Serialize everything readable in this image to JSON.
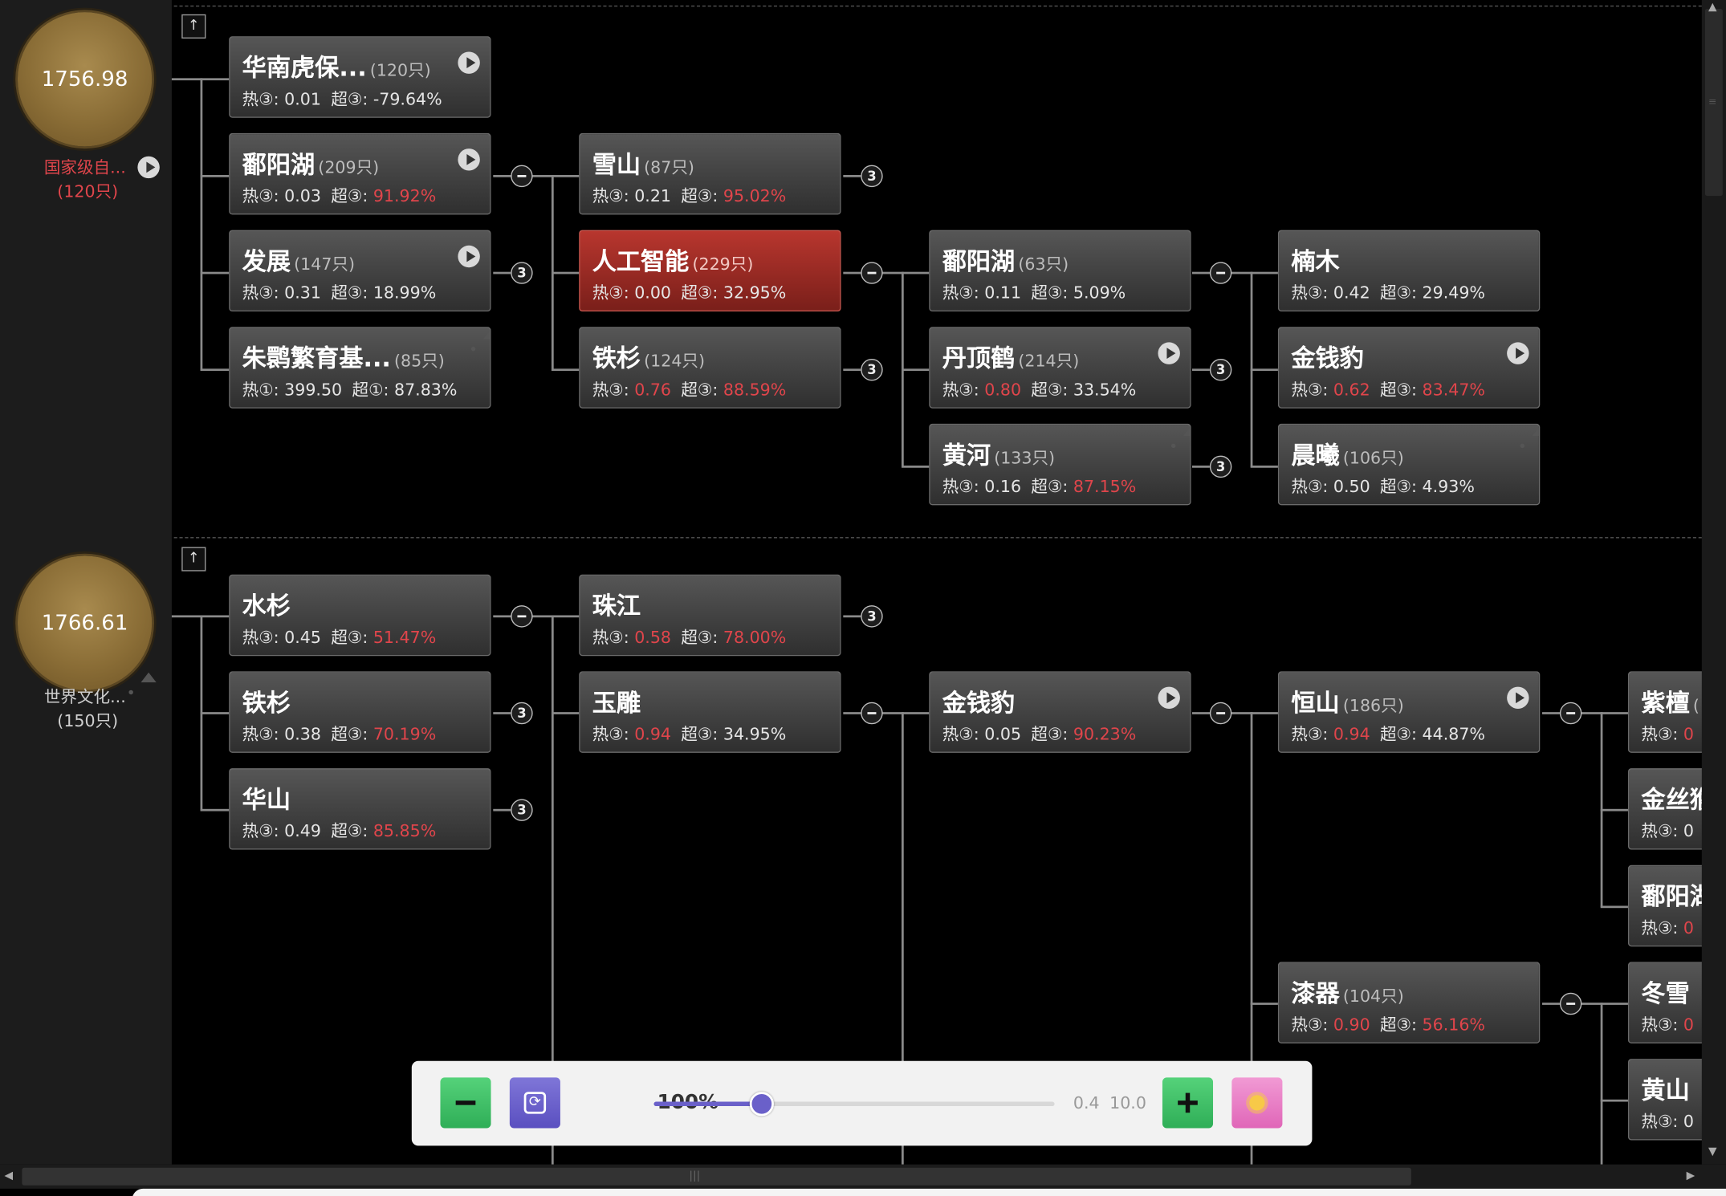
{
  "colors": {
    "accent_red": "#e0454b",
    "coin_gold": "#8a6d36",
    "selected_node": "#a82e27"
  },
  "groups": [
    {
      "value": "1756.98",
      "label": "国家级自...",
      "count": "(120只)",
      "icon": "play-icon",
      "label_color": "red"
    },
    {
      "value": "1766.61",
      "label": "世界文化...",
      "count": "(150只)",
      "icon": "image-icon",
      "label_color": "grey"
    }
  ],
  "nodes": [
    {
      "name": "华南虎保...",
      "count": "(120只)",
      "h_label": "热③:",
      "h_val": "0.01",
      "h_red": false,
      "c_label": "超③:",
      "c_val": "-79.64%",
      "c_red": false,
      "icon": "play-icon",
      "selected": false
    },
    {
      "name": "鄱阳湖",
      "count": "(209只)",
      "h_label": "热③:",
      "h_val": "0.03",
      "h_red": false,
      "c_label": "超③:",
      "c_val": "91.92%",
      "c_red": true,
      "icon": "play-icon",
      "selected": false
    },
    {
      "name": "发展",
      "count": "(147只)",
      "h_label": "热③:",
      "h_val": "0.31",
      "h_red": false,
      "c_label": "超③:",
      "c_val": "18.99%",
      "c_red": false,
      "icon": "play-icon",
      "selected": false
    },
    {
      "name": "朱鹮繁育基...",
      "count": "(85只)",
      "h_label": "热①:",
      "h_val": "399.50",
      "h_red": false,
      "c_label": "超①:",
      "c_val": "87.83%",
      "c_red": false,
      "icon": "image-icon",
      "selected": false
    },
    {
      "name": "雪山",
      "count": "(87只)",
      "h_label": "热③:",
      "h_val": "0.21",
      "h_red": false,
      "c_label": "超③:",
      "c_val": "95.02%",
      "c_red": true,
      "icon": "",
      "selected": false
    },
    {
      "name": "人工智能",
      "count": "(229只)",
      "h_label": "热③:",
      "h_val": "0.00",
      "h_red": false,
      "c_label": "超③:",
      "c_val": "32.95%",
      "c_red": false,
      "icon": "",
      "selected": true
    },
    {
      "name": "铁杉",
      "count": "(124只)",
      "h_label": "热③:",
      "h_val": "0.76",
      "h_red": true,
      "c_label": "超③:",
      "c_val": "88.59%",
      "c_red": true,
      "icon": "",
      "selected": false
    },
    {
      "name": "鄱阳湖",
      "count": "(63只)",
      "h_label": "热③:",
      "h_val": "0.11",
      "h_red": false,
      "c_label": "超③:",
      "c_val": "5.09%",
      "c_red": false,
      "icon": "",
      "selected": false
    },
    {
      "name": "丹顶鹤",
      "count": "(214只)",
      "h_label": "热③:",
      "h_val": "0.80",
      "h_red": true,
      "c_label": "超③:",
      "c_val": "33.54%",
      "c_red": false,
      "icon": "play-icon",
      "selected": false
    },
    {
      "name": "黄河",
      "count": "(133只)",
      "h_label": "热③:",
      "h_val": "0.16",
      "h_red": false,
      "c_label": "超③:",
      "c_val": "87.15%",
      "c_red": true,
      "icon": "image-icon",
      "selected": false
    },
    {
      "name": "楠木",
      "count": "",
      "h_label": "热③:",
      "h_val": "0.42",
      "h_red": false,
      "c_label": "超③:",
      "c_val": "29.49%",
      "c_red": false,
      "icon": "",
      "selected": false
    },
    {
      "name": "金钱豹",
      "count": "",
      "h_label": "热③:",
      "h_val": "0.62",
      "h_red": true,
      "c_label": "超③:",
      "c_val": "83.47%",
      "c_red": true,
      "icon": "play-icon",
      "selected": false
    },
    {
      "name": "晨曦",
      "count": "(106只)",
      "h_label": "热③:",
      "h_val": "0.50",
      "h_red": false,
      "c_label": "超③:",
      "c_val": "4.93%",
      "c_red": false,
      "icon": "image-icon",
      "selected": false
    },
    {
      "name": "水杉",
      "count": "",
      "h_label": "热③:",
      "h_val": "0.45",
      "h_red": false,
      "c_label": "超③:",
      "c_val": "51.47%",
      "c_red": true,
      "icon": "",
      "selected": false
    },
    {
      "name": "铁杉",
      "count": "",
      "h_label": "热③:",
      "h_val": "0.38",
      "h_red": false,
      "c_label": "超③:",
      "c_val": "70.19%",
      "c_red": true,
      "icon": "",
      "selected": false
    },
    {
      "name": "华山",
      "count": "",
      "h_label": "热③:",
      "h_val": "0.49",
      "h_red": false,
      "c_label": "超③:",
      "c_val": "85.85%",
      "c_red": true,
      "icon": "",
      "selected": false
    },
    {
      "name": "珠江",
      "count": "",
      "h_label": "热③:",
      "h_val": "0.58",
      "h_red": true,
      "c_label": "超③:",
      "c_val": "78.00%",
      "c_red": true,
      "icon": "",
      "selected": false
    },
    {
      "name": "玉雕",
      "count": "",
      "h_label": "热③:",
      "h_val": "0.94",
      "h_red": true,
      "c_label": "超③:",
      "c_val": "34.95%",
      "c_red": false,
      "icon": "",
      "selected": false
    },
    {
      "name": "金钱豹",
      "count": "",
      "h_label": "热③:",
      "h_val": "0.05",
      "h_red": false,
      "c_label": "超③:",
      "c_val": "90.23%",
      "c_red": true,
      "icon": "play-icon",
      "selected": false
    },
    {
      "name": "恒山",
      "count": "(186只)",
      "h_label": "热③:",
      "h_val": "0.94",
      "h_red": true,
      "c_label": "超③:",
      "c_val": "44.87%",
      "c_red": false,
      "icon": "play-icon",
      "selected": false
    },
    {
      "name": "漆器",
      "count": "(104只)",
      "h_label": "热③:",
      "h_val": "0.90",
      "h_red": true,
      "c_label": "超③:",
      "c_val": "56.16%",
      "c_red": true,
      "icon": "",
      "selected": false
    },
    {
      "name": "紫檀",
      "count": "(",
      "h_label": "热③:",
      "h_val": "0",
      "h_red": true,
      "c_label": "",
      "c_val": "",
      "c_red": false,
      "icon": "",
      "selected": false
    },
    {
      "name": "金丝猴",
      "count": "",
      "h_label": "热③:",
      "h_val": "0",
      "h_red": false,
      "c_label": "",
      "c_val": "",
      "c_red": false,
      "icon": "",
      "selected": false
    },
    {
      "name": "鄱阳湖",
      "count": "",
      "h_label": "热③:",
      "h_val": "0",
      "h_red": true,
      "c_label": "",
      "c_val": "",
      "c_red": false,
      "icon": "",
      "selected": false
    },
    {
      "name": "冬雪",
      "count": "",
      "h_label": "热③:",
      "h_val": "0",
      "h_red": true,
      "c_label": "",
      "c_val": "",
      "c_red": false,
      "icon": "",
      "selected": false
    },
    {
      "name": "黄山",
      "count": "",
      "h_label": "热③:",
      "h_val": "0",
      "h_red": false,
      "c_label": "",
      "c_val": "",
      "c_red": false,
      "icon": "",
      "selected": false
    }
  ],
  "badges": [
    {
      "type": "minus",
      "text": ""
    },
    {
      "type": "count",
      "text": "3"
    },
    {
      "type": "count",
      "text": "3"
    },
    {
      "type": "minus",
      "text": ""
    },
    {
      "type": "count",
      "text": "3"
    },
    {
      "type": "minus",
      "text": ""
    },
    {
      "type": "count",
      "text": "3"
    },
    {
      "type": "count",
      "text": "3"
    },
    {
      "type": "minus",
      "text": ""
    },
    {
      "type": "count",
      "text": "3"
    },
    {
      "type": "count",
      "text": "3"
    },
    {
      "type": "count",
      "text": "3"
    },
    {
      "type": "minus",
      "text": ""
    },
    {
      "type": "minus",
      "text": ""
    },
    {
      "type": "minus",
      "text": ""
    },
    {
      "type": "minus",
      "text": ""
    }
  ],
  "toolbar": {
    "zoom_label": "100%",
    "zoom_fraction": 0.27,
    "min_label": "0.4",
    "max_label": "10.0",
    "buttons": [
      {
        "name": "zoom-out-button",
        "icon": "minus-icon"
      },
      {
        "name": "reset-button",
        "icon": "refresh-icon"
      },
      {
        "name": "zoom-in-button",
        "icon": "plus-icon"
      },
      {
        "name": "theme-button",
        "icon": "sun-icon"
      }
    ]
  },
  "scrollbars": {
    "vertical_grip": "≡",
    "horizontal_grip": "|||",
    "left_arrow": "◀",
    "right_arrow": "▶",
    "up_arrow": "▲",
    "down_arrow": "▼"
  }
}
